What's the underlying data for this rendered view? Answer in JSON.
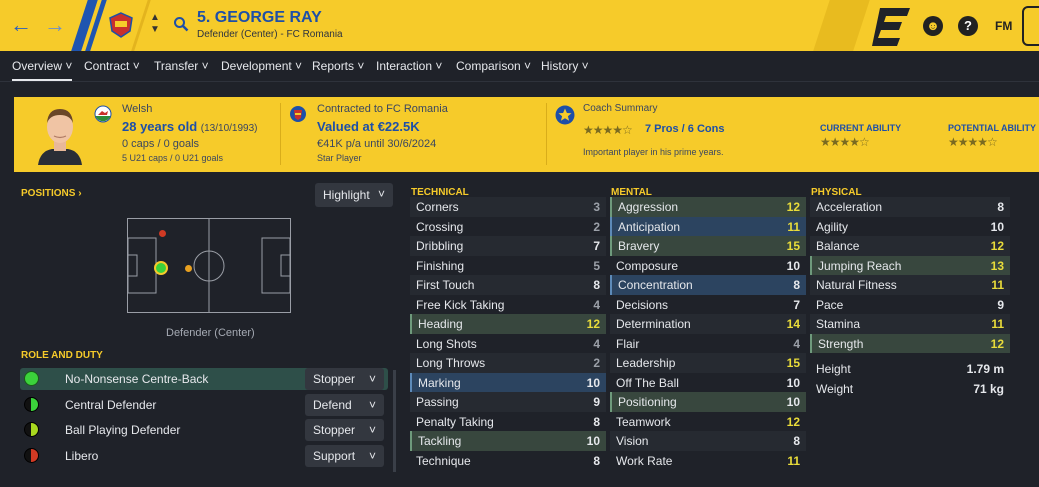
{
  "header": {
    "title": "5. GEORGE RAY",
    "subtitle": "Defender (Center) - FC Romania",
    "fm_label": "FM"
  },
  "tabs": [
    "Overview",
    "Contract",
    "Transfer",
    "Development",
    "Reports",
    "Interaction",
    "Comparison",
    "History"
  ],
  "banner": {
    "nationality": "Welsh",
    "age": "28 years old",
    "dob": "(13/10/1993)",
    "caps": "0 caps / 0 goals",
    "u21": "5 U21 caps / 0 U21 goals",
    "contract_club": "Contracted to FC Romania",
    "value": "Valued at €22.5K",
    "wage": "€41K p/a until 30/6/2024",
    "status": "Star Player",
    "coach_title": "Coach Summary",
    "coach_pros": "7 Pros / 6 Cons",
    "coach_note": "Important player in his prime years.",
    "current_ability_label": "CURRENT ABILITY",
    "potential_ability_label": "POTENTIAL ABILITY",
    "coach_stars": 3.5,
    "current_ability_stars": 3.5,
    "potential_ability_stars": 3.5
  },
  "positions": {
    "label": "POSITIONS",
    "highlight_button": "Highlight",
    "position_label": "Defender (Center)"
  },
  "roles": {
    "label": "ROLE AND DUTY",
    "items": [
      {
        "name": "No-Nonsense Centre-Back",
        "duty": "Stopper"
      },
      {
        "name": "Central Defender",
        "duty": "Defend"
      },
      {
        "name": "Ball Playing Defender",
        "duty": "Stopper"
      },
      {
        "name": "Libero",
        "duty": "Support"
      }
    ]
  },
  "technical": {
    "label": "TECHNICAL",
    "items": [
      {
        "name": "Corners",
        "value": "3"
      },
      {
        "name": "Crossing",
        "value": "2"
      },
      {
        "name": "Dribbling",
        "value": "7"
      },
      {
        "name": "Finishing",
        "value": "5"
      },
      {
        "name": "First Touch",
        "value": "8"
      },
      {
        "name": "Free Kick Taking",
        "value": "4"
      },
      {
        "name": "Heading",
        "value": "12"
      },
      {
        "name": "Long Shots",
        "value": "4"
      },
      {
        "name": "Long Throws",
        "value": "2"
      },
      {
        "name": "Marking",
        "value": "10"
      },
      {
        "name": "Passing",
        "value": "9"
      },
      {
        "name": "Penalty Taking",
        "value": "8"
      },
      {
        "name": "Tackling",
        "value": "10"
      },
      {
        "name": "Technique",
        "value": "8"
      }
    ]
  },
  "mental": {
    "label": "MENTAL",
    "items": [
      {
        "name": "Aggression",
        "value": "12"
      },
      {
        "name": "Anticipation",
        "value": "11"
      },
      {
        "name": "Bravery",
        "value": "15"
      },
      {
        "name": "Composure",
        "value": "10"
      },
      {
        "name": "Concentration",
        "value": "8"
      },
      {
        "name": "Decisions",
        "value": "7"
      },
      {
        "name": "Determination",
        "value": "14"
      },
      {
        "name": "Flair",
        "value": "4"
      },
      {
        "name": "Leadership",
        "value": "15"
      },
      {
        "name": "Off The Ball",
        "value": "10"
      },
      {
        "name": "Positioning",
        "value": "10"
      },
      {
        "name": "Teamwork",
        "value": "12"
      },
      {
        "name": "Vision",
        "value": "8"
      },
      {
        "name": "Work Rate",
        "value": "11"
      }
    ]
  },
  "physical": {
    "label": "PHYSICAL",
    "items": [
      {
        "name": "Acceleration",
        "value": "8"
      },
      {
        "name": "Agility",
        "value": "10"
      },
      {
        "name": "Balance",
        "value": "12"
      },
      {
        "name": "Jumping Reach",
        "value": "13"
      },
      {
        "name": "Natural Fitness",
        "value": "11"
      },
      {
        "name": "Pace",
        "value": "9"
      },
      {
        "name": "Stamina",
        "value": "11"
      },
      {
        "name": "Strength",
        "value": "12"
      }
    ],
    "height_label": "Height",
    "height_value": "1.79 m",
    "weight_label": "Weight",
    "weight_value": "71 kg"
  },
  "colors": {
    "header_yellow": "#f6cb2a",
    "accent_blue": "#1d4fa8",
    "highlight_yellow": "#e9dc3a",
    "key_green": "#38473e",
    "key_blue": "#2c4460"
  }
}
